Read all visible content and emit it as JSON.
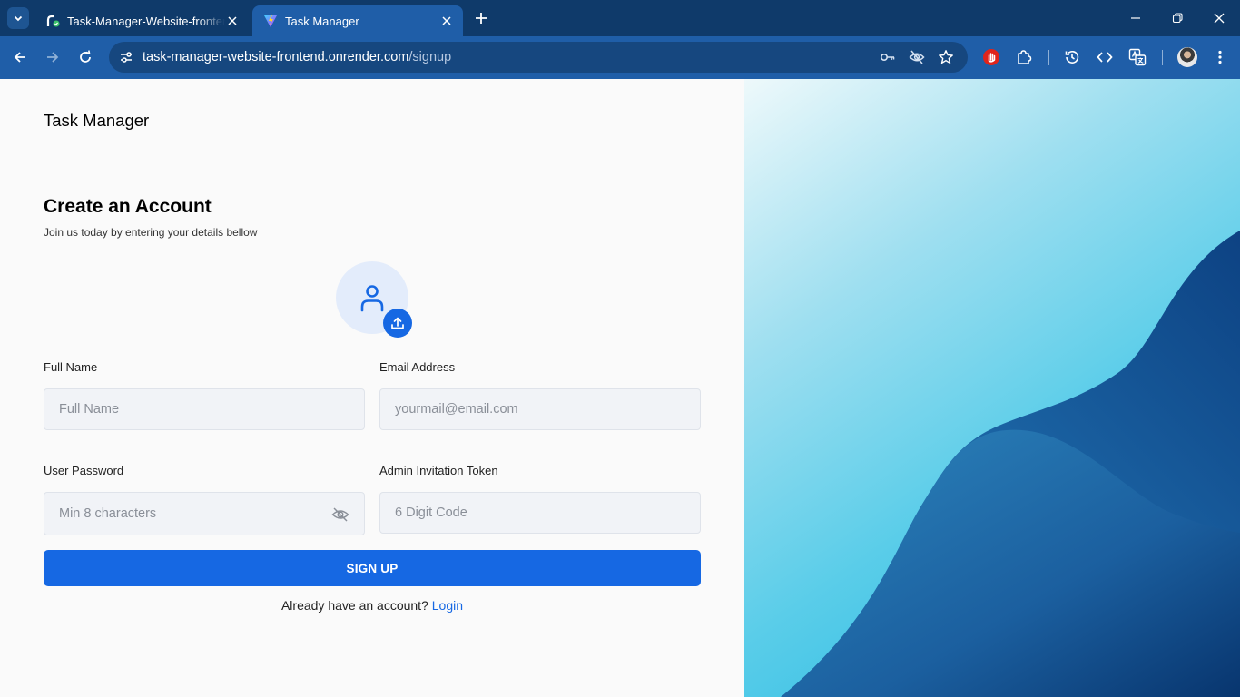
{
  "browser": {
    "tabs": [
      {
        "title": "Task-Manager-Website-frontend",
        "active": false
      },
      {
        "title": "Task Manager",
        "active": true
      }
    ],
    "url_host": "task-manager-website-frontend.onrender.com",
    "url_path": "/signup",
    "colors": {
      "frame": "#0f3a6a",
      "toolbar": "#1f5ea8",
      "omnibox": "#16477f"
    }
  },
  "app": {
    "brand": "Task Manager",
    "heading": "Create an Account",
    "subheading": "Join us today by entering your details bellow"
  },
  "form": {
    "full_name": {
      "label": "Full Name",
      "placeholder": "Full Name"
    },
    "email": {
      "label": "Email Address",
      "placeholder": "yourmail@email.com"
    },
    "password": {
      "label": "User Password",
      "placeholder": "Min 8 characters"
    },
    "token": {
      "label": "Admin Invitation Token",
      "placeholder": "6 Digit Code"
    },
    "submit_label": "SIGN UP",
    "login_prompt": "Already have an account?",
    "login_link": "Login"
  },
  "colors": {
    "accent": "#1668e3",
    "panel_dark": "#0b3a78",
    "panel_light": "#5ccfe9"
  }
}
